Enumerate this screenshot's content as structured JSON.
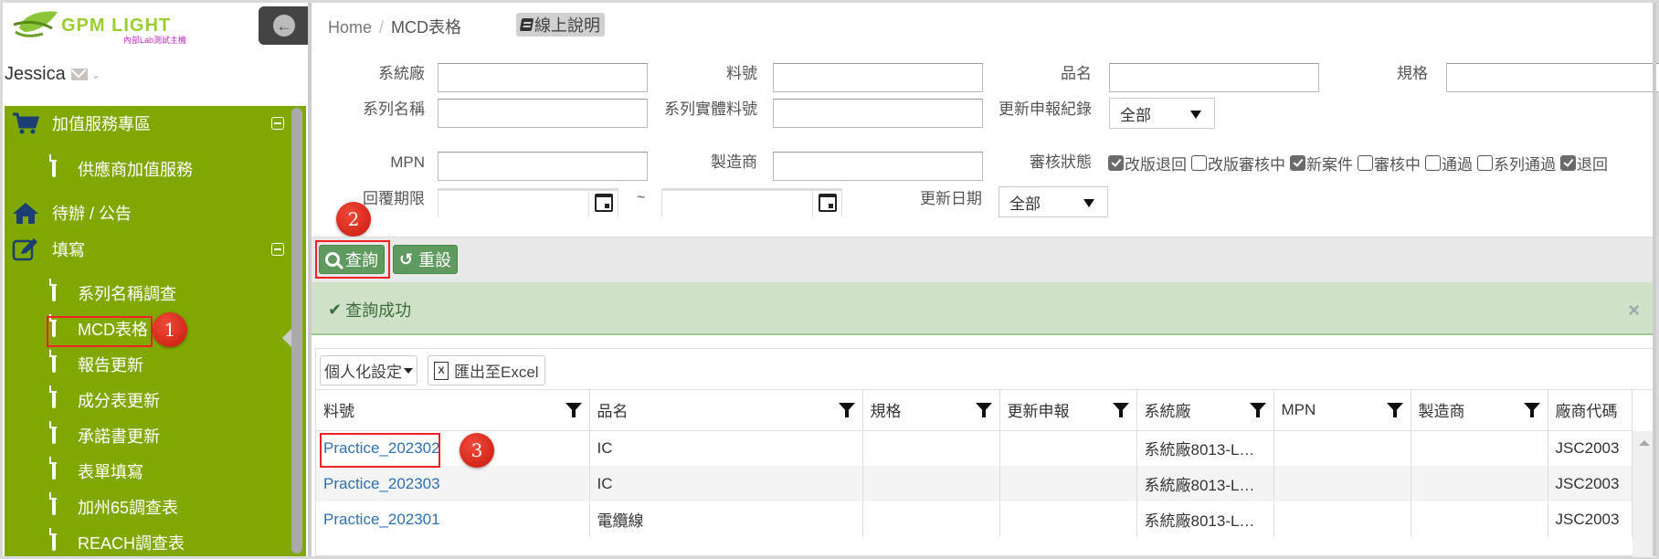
{
  "app": {
    "logo_title": "GPM LIGHT",
    "logo_subtitle": "內部Lab測試主機"
  },
  "user": {
    "name": "Jessica"
  },
  "sidebar": {
    "items": [
      {
        "label": "加值服務專區",
        "icon": "cart-icon",
        "level": 1,
        "collapsible": true
      },
      {
        "label": "供應商加值服務",
        "icon": "document-icon",
        "level": 2
      },
      {
        "label": "待辦 / 公告",
        "icon": "home-icon",
        "level": 1
      },
      {
        "label": "填寫",
        "icon": "edit-icon",
        "level": 1,
        "collapsible": true
      },
      {
        "label": "系列名稱調查",
        "icon": "document-icon",
        "level": 2
      },
      {
        "label": "MCD表格",
        "icon": "document-icon",
        "level": 2,
        "active": true
      },
      {
        "label": "報告更新",
        "icon": "document-icon",
        "level": 2
      },
      {
        "label": "成分表更新",
        "icon": "document-icon",
        "level": 2
      },
      {
        "label": "承諾書更新",
        "icon": "document-icon",
        "level": 2
      },
      {
        "label": "表單填寫",
        "icon": "document-icon",
        "level": 2
      },
      {
        "label": "加州65調查表",
        "icon": "document-icon",
        "level": 2
      },
      {
        "label": "REACH調查表",
        "icon": "document-icon",
        "level": 2
      }
    ]
  },
  "breadcrumb": {
    "home": "Home",
    "separator": "/",
    "current": "MCD表格"
  },
  "help_button": "線上說明",
  "filters": {
    "system_factory": {
      "label": "系統廠",
      "value": ""
    },
    "part_no": {
      "label": "料號",
      "value": ""
    },
    "product_name": {
      "label": "品名",
      "value": ""
    },
    "spec": {
      "label": "規格",
      "value": ""
    },
    "series_name": {
      "label": "系列名稱",
      "value": ""
    },
    "series_part_no": {
      "label": "系列實體料號",
      "value": ""
    },
    "update_record": {
      "label": "更新申報紀錄",
      "selected": "全部"
    },
    "mpn": {
      "label": "MPN",
      "value": ""
    },
    "manufacturer": {
      "label": "製造商",
      "value": ""
    },
    "review_status": {
      "label": "審核狀態",
      "options": [
        {
          "label": "改版退回",
          "checked": true
        },
        {
          "label": "改版審核中",
          "checked": false
        },
        {
          "label": "新案件",
          "checked": true
        },
        {
          "label": "審核中",
          "checked": false
        },
        {
          "label": "通過",
          "checked": false
        },
        {
          "label": "系列通過",
          "checked": false
        },
        {
          "label": "退回",
          "checked": true
        }
      ]
    },
    "reply_deadline": {
      "label": "回覆期限",
      "from": "",
      "to": "",
      "range_sep": "~"
    },
    "update_date": {
      "label": "更新日期",
      "selected": "全部"
    }
  },
  "actions": {
    "query": "查詢",
    "reset": "重設"
  },
  "alert": {
    "message": "查詢成功",
    "close": "×"
  },
  "grid_toolbar": {
    "personalize": "個人化設定",
    "export": "匯出至Excel"
  },
  "table": {
    "columns": [
      "料號",
      "品名",
      "規格",
      "更新申報",
      "系統廠",
      "MPN",
      "製造商",
      "廠商代碼"
    ],
    "rows": [
      [
        "Practice_202302",
        "IC",
        "",
        "",
        "系統廠8013-L…",
        "",
        "",
        "JSC2003"
      ],
      [
        "Practice_202303",
        "IC",
        "",
        "",
        "系統廠8013-L…",
        "",
        "",
        "JSC2003"
      ],
      [
        "Practice_202301",
        "電纜線",
        "",
        "",
        "系統廠8013-L…",
        "",
        "",
        "JSC2003"
      ]
    ]
  },
  "annotations": [
    "1",
    "2",
    "3"
  ]
}
